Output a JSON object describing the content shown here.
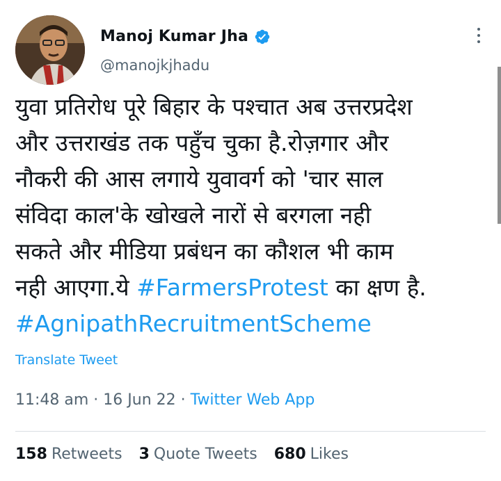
{
  "author": {
    "name": "Manoj Kumar Jha",
    "handle": "@manojkjhadu"
  },
  "tweet": {
    "lines": [
      "युवा प्रतिरोध पूरे बिहार के पश्चात अब उत्तरप्रदेश",
      "और उत्तराखंड तक पहुँच चुका है.रोज़गार और",
      "नौकरी की आस लगाये युवावर्ग को 'चार साल",
      "संविदा काल'के खोखले नारों से बरगला नही",
      "सकते और मीडिया प्रबंधन का कौशल भी काम"
    ],
    "line6_before": "नही आएगा.ये ",
    "hashtag1": "#FarmersProtest",
    "line6_after": " का क्षण है.",
    "hashtag2": "#AgnipathRecruitmentScheme"
  },
  "translate_label": "Translate Tweet",
  "meta": {
    "time": "11:48 am",
    "sep1": " · ",
    "date": "16 Jun 22",
    "sep2": " · ",
    "app": "Twitter Web App"
  },
  "stats": {
    "retweets_count": "158",
    "retweets_label": "Retweets",
    "quotes_count": "3",
    "quotes_label": "Quote Tweets",
    "likes_count": "680",
    "likes_label": "Likes"
  },
  "colors": {
    "accent": "#1d9bf0",
    "text": "#0f1419",
    "muted": "#536471"
  },
  "icons": [
    "verified-badge-icon",
    "more-options-icon"
  ]
}
